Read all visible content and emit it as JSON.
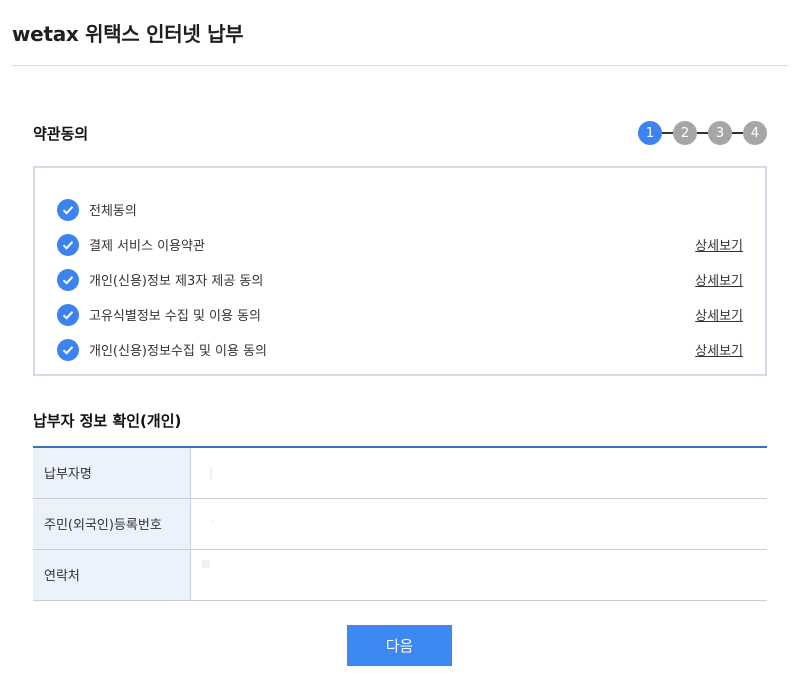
{
  "header": {
    "title": "wetax 위택스 인터넷 납부"
  },
  "terms": {
    "title": "약관동의",
    "steps": [
      "1",
      "2",
      "3",
      "4"
    ],
    "active_step": 1,
    "items": [
      {
        "label": "전체동의",
        "link": ""
      },
      {
        "label": "결제 서비스 이용약관",
        "link": "상세보기"
      },
      {
        "label": "개인(신용)정보 제3자 제공 동의",
        "link": "상세보기"
      },
      {
        "label": "고유식별정보 수집 및 이용 동의",
        "link": "상세보기"
      },
      {
        "label": "개인(신용)정보수집 및 이용 동의",
        "link": "상세보기"
      }
    ]
  },
  "payer": {
    "title": "납부자 정보 확인(개인)",
    "rows": [
      {
        "label": "납부자명",
        "value": ""
      },
      {
        "label": "주민(외국인)등록번호",
        "value": ""
      },
      {
        "label": "연락처",
        "value": ""
      }
    ]
  },
  "actions": {
    "next_label": "다음"
  },
  "colors": {
    "accent": "#3d82f1",
    "step_inactive": "#a6a6a6",
    "table_header_bg": "#ebf2fc",
    "table_top_border": "#3a6fc4"
  }
}
